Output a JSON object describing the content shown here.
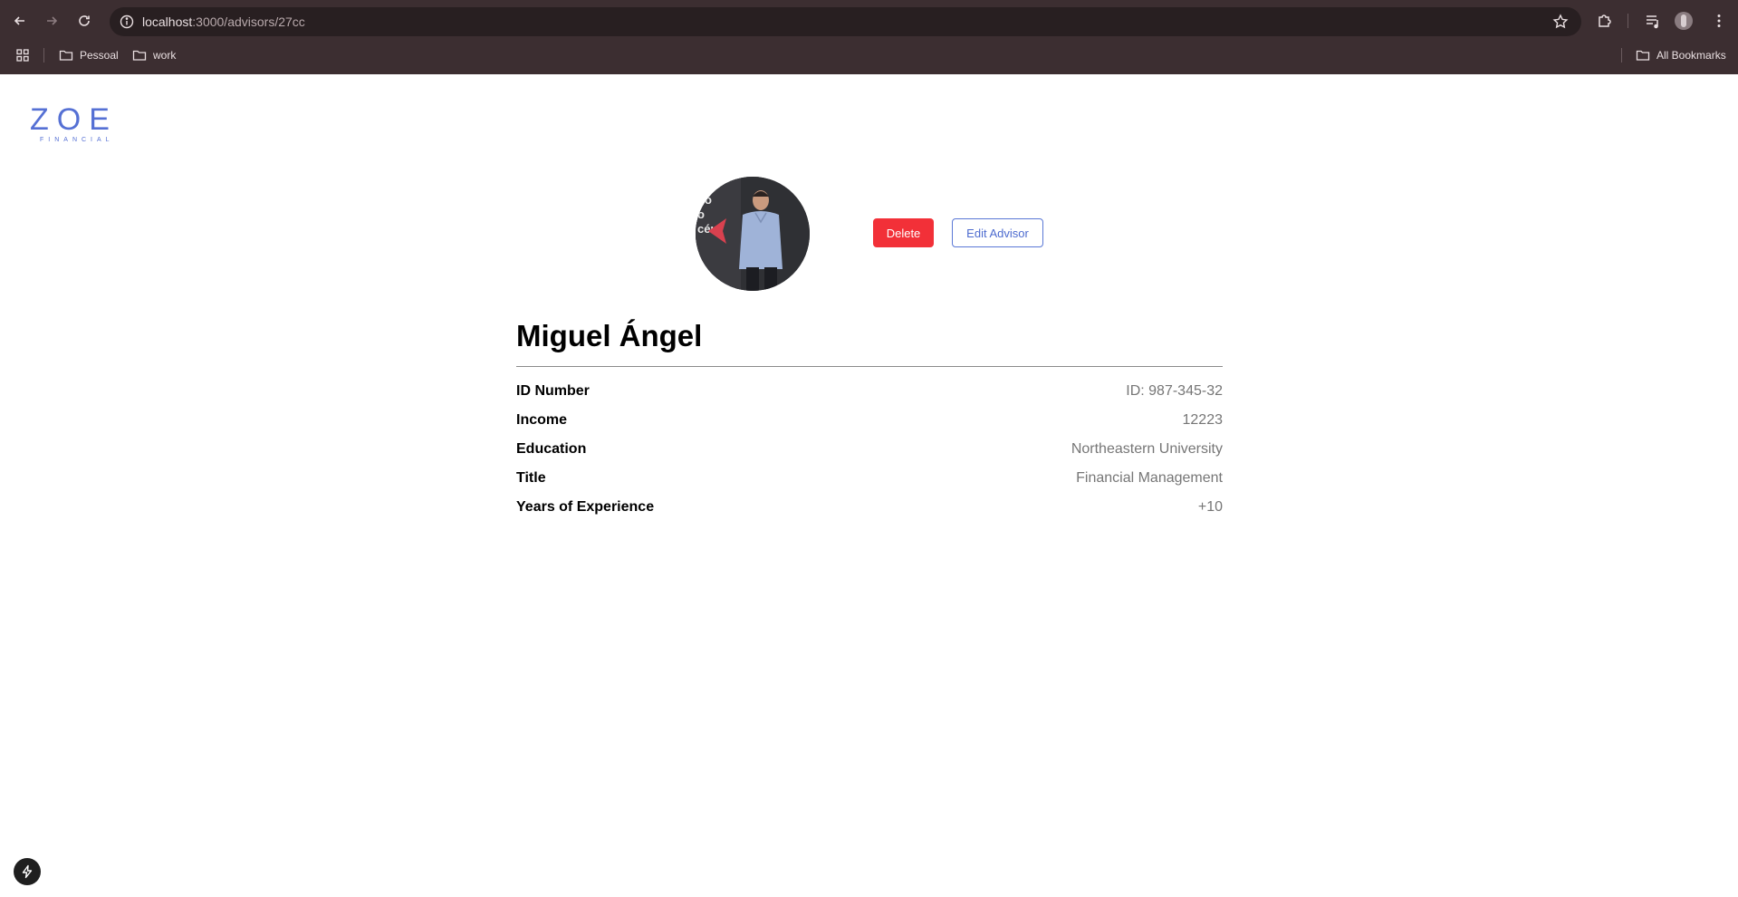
{
  "browser": {
    "url_host": "localhost",
    "url_rest": ":3000/advisors/27cc",
    "bookmarks": [
      {
        "label": "Pessoal"
      },
      {
        "label": "work"
      }
    ],
    "all_bookmarks_label": "All Bookmarks"
  },
  "logo": {
    "word": "ZOE",
    "subtitle": "FINANCIAL",
    "color": "#5570d4"
  },
  "actions": {
    "delete_label": "Delete",
    "edit_label": "Edit Advisor",
    "delete_color": "#f23038"
  },
  "advisor": {
    "name": "Miguel Ángel",
    "fields": [
      {
        "label": "ID Number",
        "value": "ID: 987-345-32"
      },
      {
        "label": "Income",
        "value": "12223"
      },
      {
        "label": "Education",
        "value": "Northeastern University"
      },
      {
        "label": "Title",
        "value": "Financial Management"
      },
      {
        "label": "Years of Experience",
        "value": "+10"
      }
    ]
  },
  "icons": {
    "back": "arrow-left-icon",
    "forward": "arrow-right-icon",
    "reload": "reload-icon",
    "site_info": "info-icon",
    "bookmark_star": "star-icon",
    "extensions": "puzzle-icon",
    "media": "media-queue-icon",
    "menu": "kebab-menu-icon",
    "apps": "apps-grid-icon",
    "folder": "folder-icon",
    "dev_tools": "bolt-icon"
  }
}
